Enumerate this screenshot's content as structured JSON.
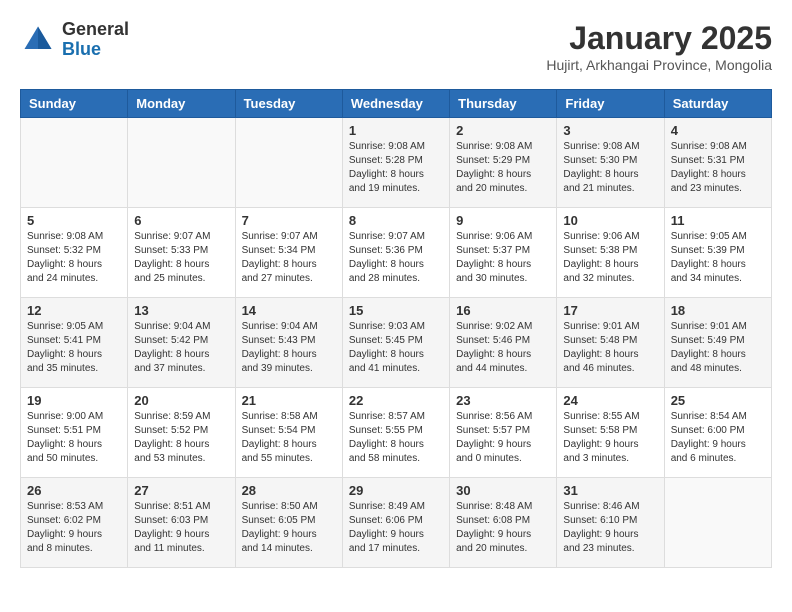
{
  "header": {
    "logo_general": "General",
    "logo_blue": "Blue",
    "month_title": "January 2025",
    "location": "Hujirt, Arkhangai Province, Mongolia"
  },
  "days_of_week": [
    "Sunday",
    "Monday",
    "Tuesday",
    "Wednesday",
    "Thursday",
    "Friday",
    "Saturday"
  ],
  "weeks": [
    [
      {
        "day": "",
        "info": ""
      },
      {
        "day": "",
        "info": ""
      },
      {
        "day": "",
        "info": ""
      },
      {
        "day": "1",
        "info": "Sunrise: 9:08 AM\nSunset: 5:28 PM\nDaylight: 8 hours\nand 19 minutes."
      },
      {
        "day": "2",
        "info": "Sunrise: 9:08 AM\nSunset: 5:29 PM\nDaylight: 8 hours\nand 20 minutes."
      },
      {
        "day": "3",
        "info": "Sunrise: 9:08 AM\nSunset: 5:30 PM\nDaylight: 8 hours\nand 21 minutes."
      },
      {
        "day": "4",
        "info": "Sunrise: 9:08 AM\nSunset: 5:31 PM\nDaylight: 8 hours\nand 23 minutes."
      }
    ],
    [
      {
        "day": "5",
        "info": "Sunrise: 9:08 AM\nSunset: 5:32 PM\nDaylight: 8 hours\nand 24 minutes."
      },
      {
        "day": "6",
        "info": "Sunrise: 9:07 AM\nSunset: 5:33 PM\nDaylight: 8 hours\nand 25 minutes."
      },
      {
        "day": "7",
        "info": "Sunrise: 9:07 AM\nSunset: 5:34 PM\nDaylight: 8 hours\nand 27 minutes."
      },
      {
        "day": "8",
        "info": "Sunrise: 9:07 AM\nSunset: 5:36 PM\nDaylight: 8 hours\nand 28 minutes."
      },
      {
        "day": "9",
        "info": "Sunrise: 9:06 AM\nSunset: 5:37 PM\nDaylight: 8 hours\nand 30 minutes."
      },
      {
        "day": "10",
        "info": "Sunrise: 9:06 AM\nSunset: 5:38 PM\nDaylight: 8 hours\nand 32 minutes."
      },
      {
        "day": "11",
        "info": "Sunrise: 9:05 AM\nSunset: 5:39 PM\nDaylight: 8 hours\nand 34 minutes."
      }
    ],
    [
      {
        "day": "12",
        "info": "Sunrise: 9:05 AM\nSunset: 5:41 PM\nDaylight: 8 hours\nand 35 minutes."
      },
      {
        "day": "13",
        "info": "Sunrise: 9:04 AM\nSunset: 5:42 PM\nDaylight: 8 hours\nand 37 minutes."
      },
      {
        "day": "14",
        "info": "Sunrise: 9:04 AM\nSunset: 5:43 PM\nDaylight: 8 hours\nand 39 minutes."
      },
      {
        "day": "15",
        "info": "Sunrise: 9:03 AM\nSunset: 5:45 PM\nDaylight: 8 hours\nand 41 minutes."
      },
      {
        "day": "16",
        "info": "Sunrise: 9:02 AM\nSunset: 5:46 PM\nDaylight: 8 hours\nand 44 minutes."
      },
      {
        "day": "17",
        "info": "Sunrise: 9:01 AM\nSunset: 5:48 PM\nDaylight: 8 hours\nand 46 minutes."
      },
      {
        "day": "18",
        "info": "Sunrise: 9:01 AM\nSunset: 5:49 PM\nDaylight: 8 hours\nand 48 minutes."
      }
    ],
    [
      {
        "day": "19",
        "info": "Sunrise: 9:00 AM\nSunset: 5:51 PM\nDaylight: 8 hours\nand 50 minutes."
      },
      {
        "day": "20",
        "info": "Sunrise: 8:59 AM\nSunset: 5:52 PM\nDaylight: 8 hours\nand 53 minutes."
      },
      {
        "day": "21",
        "info": "Sunrise: 8:58 AM\nSunset: 5:54 PM\nDaylight: 8 hours\nand 55 minutes."
      },
      {
        "day": "22",
        "info": "Sunrise: 8:57 AM\nSunset: 5:55 PM\nDaylight: 8 hours\nand 58 minutes."
      },
      {
        "day": "23",
        "info": "Sunrise: 8:56 AM\nSunset: 5:57 PM\nDaylight: 9 hours\nand 0 minutes."
      },
      {
        "day": "24",
        "info": "Sunrise: 8:55 AM\nSunset: 5:58 PM\nDaylight: 9 hours\nand 3 minutes."
      },
      {
        "day": "25",
        "info": "Sunrise: 8:54 AM\nSunset: 6:00 PM\nDaylight: 9 hours\nand 6 minutes."
      }
    ],
    [
      {
        "day": "26",
        "info": "Sunrise: 8:53 AM\nSunset: 6:02 PM\nDaylight: 9 hours\nand 8 minutes."
      },
      {
        "day": "27",
        "info": "Sunrise: 8:51 AM\nSunset: 6:03 PM\nDaylight: 9 hours\nand 11 minutes."
      },
      {
        "day": "28",
        "info": "Sunrise: 8:50 AM\nSunset: 6:05 PM\nDaylight: 9 hours\nand 14 minutes."
      },
      {
        "day": "29",
        "info": "Sunrise: 8:49 AM\nSunset: 6:06 PM\nDaylight: 9 hours\nand 17 minutes."
      },
      {
        "day": "30",
        "info": "Sunrise: 8:48 AM\nSunset: 6:08 PM\nDaylight: 9 hours\nand 20 minutes."
      },
      {
        "day": "31",
        "info": "Sunrise: 8:46 AM\nSunset: 6:10 PM\nDaylight: 9 hours\nand 23 minutes."
      },
      {
        "day": "",
        "info": ""
      }
    ]
  ]
}
